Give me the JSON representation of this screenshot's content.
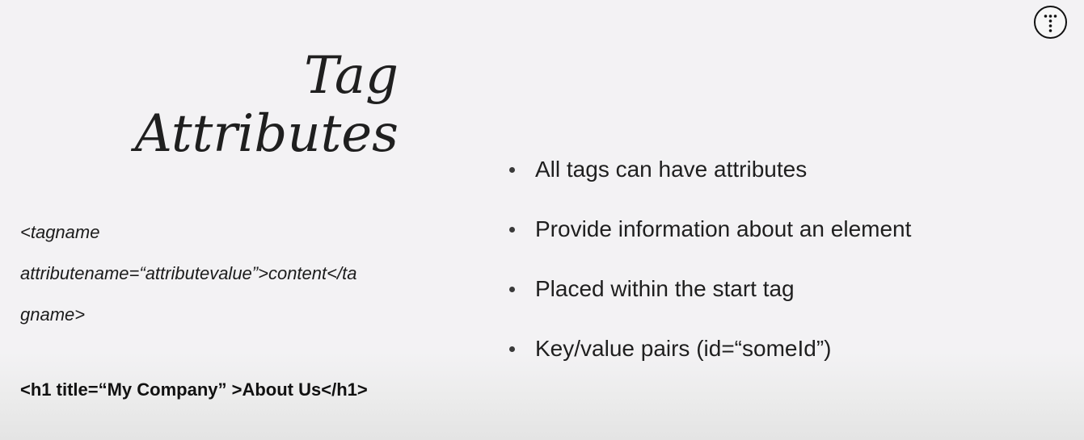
{
  "slide": {
    "title_lines": [
      "Tag",
      "Attributes"
    ],
    "syntax_lines": [
      "<tagname",
      "attributename=“attributevalue”>content</ta",
      "gname>"
    ],
    "example": "<h1 title=“My Company” >About Us</h1>",
    "bullets": [
      "All tags can have attributes",
      "Provide information about an element",
      "Placed within the start tag",
      "Key/value pairs (id=“someId”)"
    ]
  },
  "logo": {
    "icon": "t-dots-logo-icon"
  }
}
